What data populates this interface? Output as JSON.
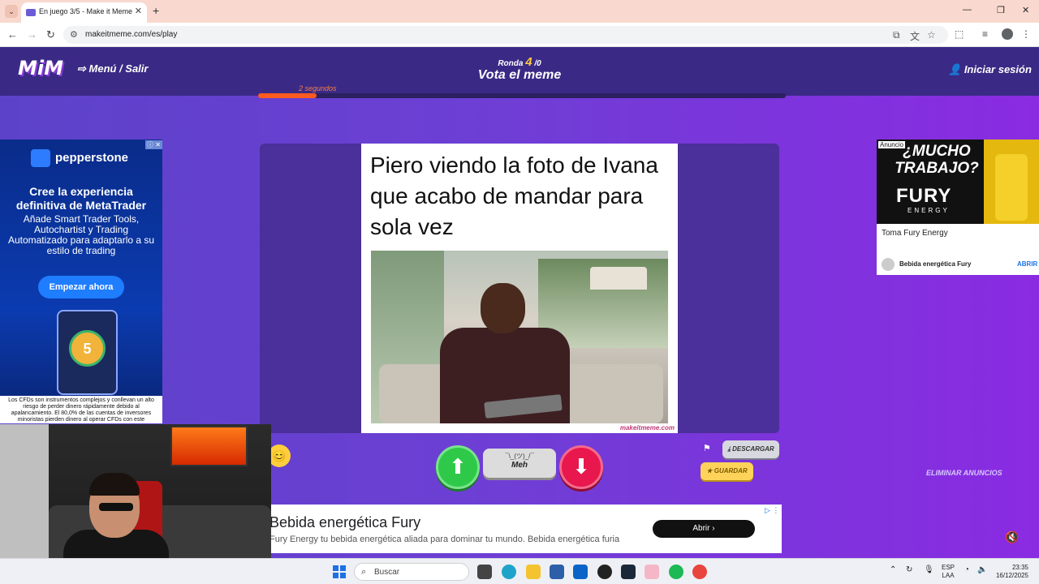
{
  "browser": {
    "tab_title": "En juego 3/5 - Make it Meme",
    "url": "makeitmeme.com/es/play"
  },
  "header": {
    "logo": "MiM",
    "menu_label": "⇨ Menú / Salir",
    "round_prefix": "Ronda",
    "round_current": "4",
    "round_total": "/0",
    "title": "Vota el meme",
    "login_label": "Iniciar sesión",
    "timer_label": "2 segundos",
    "timer_progress": 0.11
  },
  "meme": {
    "caption": "Piero viendo la foto de Ivana que acabo de mandar para sola vez",
    "watermark": "makeitmeme.com"
  },
  "vote": {
    "meh_face": "¯\\_(ツ)_/¯",
    "meh_label": "Meh",
    "download_label": "DESCARGAR",
    "save_label": "GUARDAR",
    "remove_ads_label": "ELIMINAR ANUNCIOS"
  },
  "ad_left": {
    "brand": "pepperstone",
    "headline": "Cree la experiencia definitiva de MetaTrader",
    "body": "Añade Smart Trader Tools, Autochartist y Trading Automatizado para adaptarlo a su estilo de trading",
    "cta": "Empezar ahora",
    "coin_number": "5",
    "legal": "Los CFDs son instrumentos complejos y conllevan un alto riesgo de perder dinero rápidamente debido al apalancamiento. El 80,0% de las cuentas de inversores minoristas pierden dinero al operar CFDs con este"
  },
  "ad_right": {
    "tag": "Anuncio",
    "question": "¿MUCHO TRABAJO?",
    "brand": "FURY",
    "brand_sub": "ENERGY",
    "title": "Toma Fury Energy",
    "advertiser": "Bebida energética Fury",
    "open": "ABRIR"
  },
  "ad_bottom": {
    "title": "Bebida energética Fury",
    "description": "Fury Energy tu bebida energética aliada para dominar tu mundo. Bebida energética furia",
    "open": "Abrir"
  },
  "taskbar": {
    "search_placeholder": "Buscar",
    "lang_line1": "ESP",
    "lang_line2": "LAA",
    "time": "23:35",
    "date": "16/12/2025"
  },
  "colors": {
    "accent_green": "#2fc94a",
    "accent_red": "#e8174d",
    "timer": "#ff5a1f",
    "header_bg": "#3a2a85"
  }
}
